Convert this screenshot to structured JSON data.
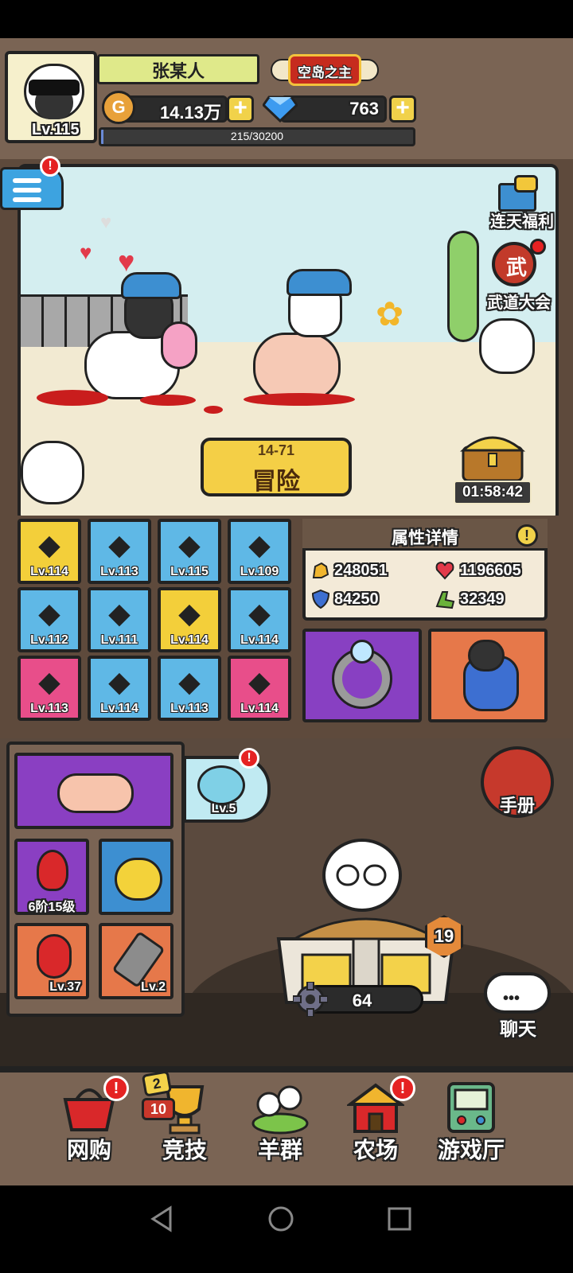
{
  "player": {
    "level": "Lv.115",
    "name": "张某人",
    "title": "空岛之主",
    "coins": "14.13万",
    "gems": "763",
    "xp_text": "215/30200",
    "xp_fraction": 0.0071
  },
  "top_right": {
    "daily_bonus": "连天福利",
    "martial_event": "武道大会"
  },
  "adventure": {
    "stage": "14-71",
    "label": "冒险"
  },
  "chest_timer": "01:58:42",
  "equipment": [
    {
      "level": "Lv.114",
      "color": "#f3cf3a",
      "icon": "golden-wheat"
    },
    {
      "level": "Lv.113",
      "color": "#5fb8e6",
      "icon": "razor"
    },
    {
      "level": "Lv.115",
      "color": "#5fb8e6",
      "icon": "feeding-trough"
    },
    {
      "level": "Lv.109",
      "color": "#5fb8e6",
      "icon": "hay-cart"
    },
    {
      "level": "Lv.112",
      "color": "#5fb8e6",
      "icon": "fountain"
    },
    {
      "level": "Lv.111",
      "color": "#5fb8e6",
      "icon": "gazebo"
    },
    {
      "level": "Lv.114",
      "color": "#f3cf3a",
      "icon": "plant-pot"
    },
    {
      "level": "Lv.114",
      "color": "#5fb8e6",
      "icon": "bonsai-tree"
    },
    {
      "level": "Lv.113",
      "color": "#e84e8a",
      "icon": "lasso"
    },
    {
      "level": "Lv.114",
      "color": "#5fb8e6",
      "icon": "signboard"
    },
    {
      "level": "Lv.113",
      "color": "#5fb8e6",
      "icon": "pitchfork"
    },
    {
      "level": "Lv.114",
      "color": "#e84e8a",
      "icon": "fence-panel"
    }
  ],
  "attributes": {
    "title": "属性详情",
    "attack": "248051",
    "health": "1196605",
    "defense": "84250",
    "speed": "32349"
  },
  "items": {
    "stone_label": "6阶15级",
    "parrot_level": "Lv.37",
    "clipper_level": "Lv.2",
    "fishbowl_level": "Lv.5"
  },
  "handbook_label": "手册",
  "chest_level": "19",
  "gear_count": "64",
  "chat_label": "聊天",
  "bottom_nav": [
    {
      "label": "网购",
      "icon": "shopping-basket-icon",
      "alert": true
    },
    {
      "label": "竞技",
      "icon": "trophy-icon",
      "alert": false
    },
    {
      "label": "羊群",
      "icon": "flock-icon",
      "alert": false
    },
    {
      "label": "农场",
      "icon": "barn-icon",
      "alert": true
    },
    {
      "label": "游戏厅",
      "icon": "arcade-icon",
      "alert": false
    }
  ],
  "trophy_badges": {
    "top": "2",
    "bottom": "10"
  },
  "alert_mark": "!"
}
